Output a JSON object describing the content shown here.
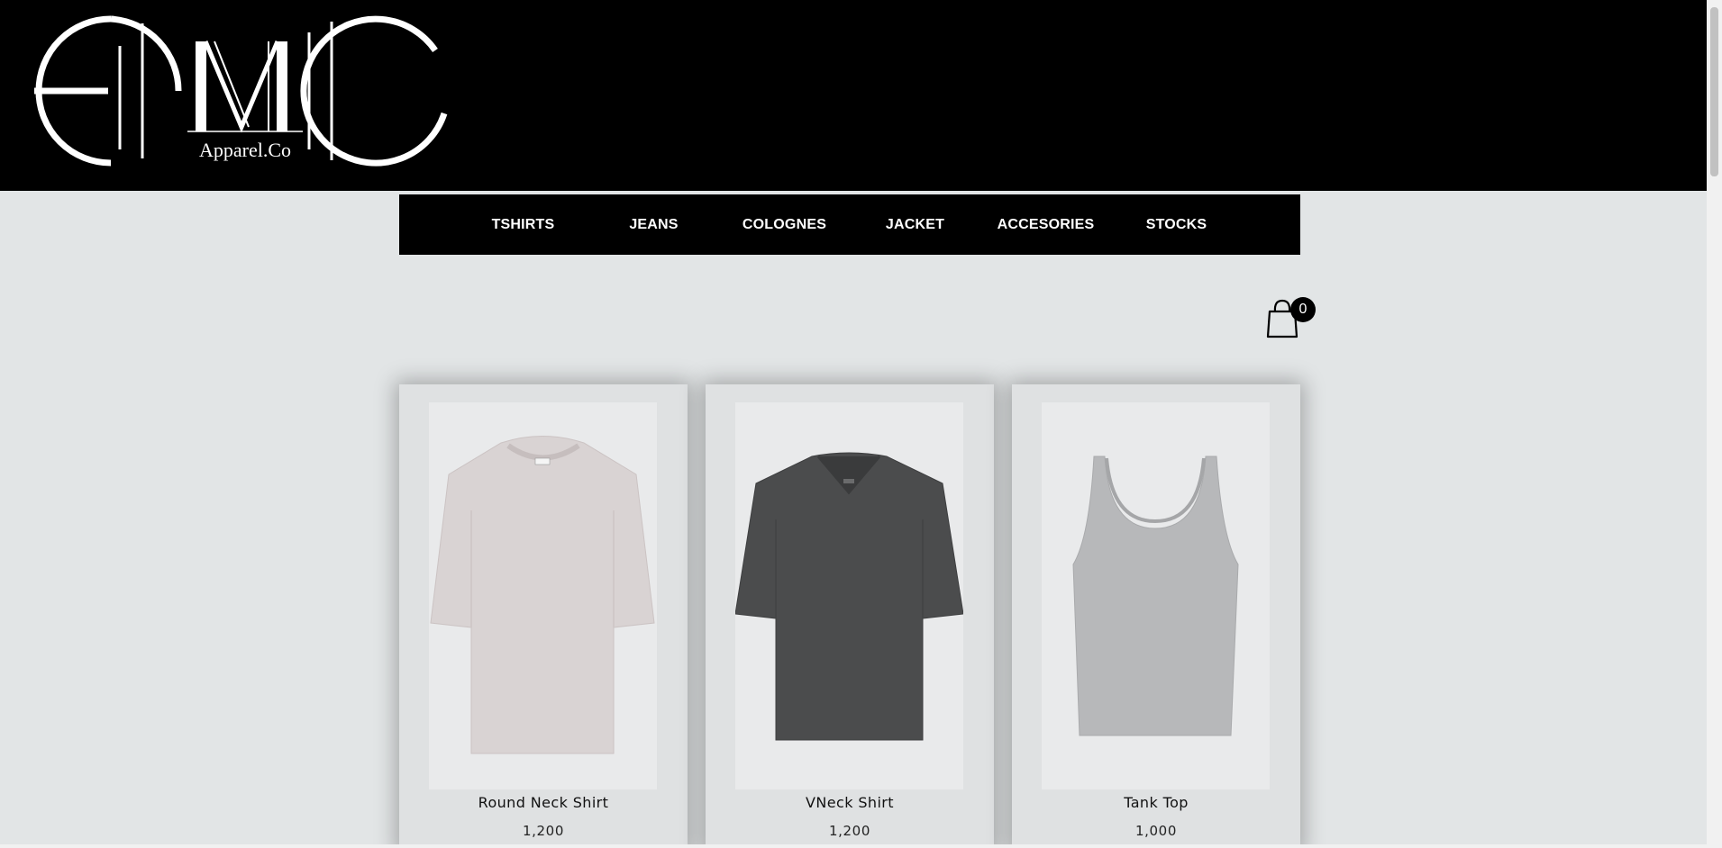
{
  "header": {
    "logo_mark": "EMC",
    "logo_subtitle": "Apparel.Co"
  },
  "nav": {
    "items": [
      {
        "label": "TSHIRTS"
      },
      {
        "label": "JEANS"
      },
      {
        "label": "COLOGNES"
      },
      {
        "label": "JACKET"
      },
      {
        "label": "ACCESORIES"
      },
      {
        "label": "STOCKS"
      }
    ]
  },
  "cart": {
    "icon": "shopping-bag-icon",
    "count": "0"
  },
  "products": [
    {
      "name": "Round Neck Shirt",
      "price": "1,200",
      "image": "round-neck-shirt-image",
      "color": "#d9d3d3"
    },
    {
      "name": "VNeck Shirt",
      "price": "1,200",
      "image": "vneck-shirt-image",
      "color": "#4b4c4d"
    },
    {
      "name": "Tank Top",
      "price": "1,000",
      "image": "tank-top-image",
      "color": "#b7b8ba"
    }
  ],
  "colors": {
    "header_bg": "#000000",
    "page_bg": "#e2e5e6",
    "card_bg": "#dfe1e2"
  }
}
